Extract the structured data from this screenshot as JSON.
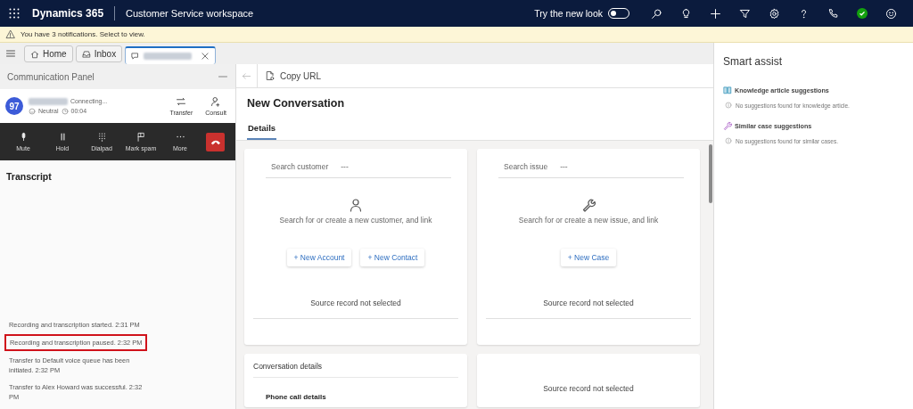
{
  "app_bar": {
    "app_name": "Dynamics 365",
    "workspace": "Customer Service workspace",
    "toggle": {
      "label": "Try the new look",
      "on": false
    }
  },
  "notification": {
    "text": "You have 3 notifications. Select to view."
  },
  "session_tabs": [
    {
      "label": "Home",
      "selected": false
    },
    {
      "label": "Inbox",
      "selected": false
    },
    {
      "selected": true
    }
  ],
  "communication_panel": {
    "title": "Communication Panel",
    "call": {
      "avatar": "97",
      "status": "Connecting...",
      "sentiment": "Neutral",
      "timer": "00:04",
      "actions": [
        "Transfer",
        "Consult"
      ]
    },
    "controls": [
      "Mute",
      "Hold",
      "Dialpad",
      "Mark spam",
      "More"
    ],
    "transcript": {
      "title": "Transcript",
      "entries": [
        {
          "text": "Recording and transcription started. 2:31 PM",
          "highlighted": false
        },
        {
          "text": "Recording and transcription paused. 2:32 PM",
          "highlighted": true
        },
        {
          "text": "Transfer to Default voice queue has been initiated. 2:32 PM",
          "highlighted": false
        },
        {
          "text": "Transfer to Alex Howard was successful. 2:32 PM",
          "highlighted": false
        }
      ]
    }
  },
  "toolbar": {
    "copy_url": "Copy URL"
  },
  "form": {
    "title": "New Conversation",
    "tabs": [
      {
        "label": "Details",
        "selected": true
      }
    ],
    "customer_card": {
      "field_label": "Search customer",
      "field_value": "---",
      "hint": "Search for or create a new customer, and link",
      "buttons": [
        "+ New Account",
        "+ New Contact"
      ],
      "footer": "Source record not selected"
    },
    "issue_card": {
      "field_label": "Search issue",
      "field_value": "---",
      "hint": "Search for or create a new issue, and link",
      "buttons": [
        "+ New Case"
      ],
      "footer": "Source record not selected"
    },
    "conversation_details": {
      "title": "Conversation details",
      "section": "Phone call details"
    },
    "source_card": {
      "text": "Source record not selected"
    }
  },
  "smart_assist": {
    "title": "Smart assist",
    "sections": [
      {
        "title": "Knowledge article suggestions",
        "message": "No suggestions found for knowledge article."
      },
      {
        "title": "Similar case suggestions",
        "message": "No suggestions found for similar cases."
      }
    ]
  }
}
